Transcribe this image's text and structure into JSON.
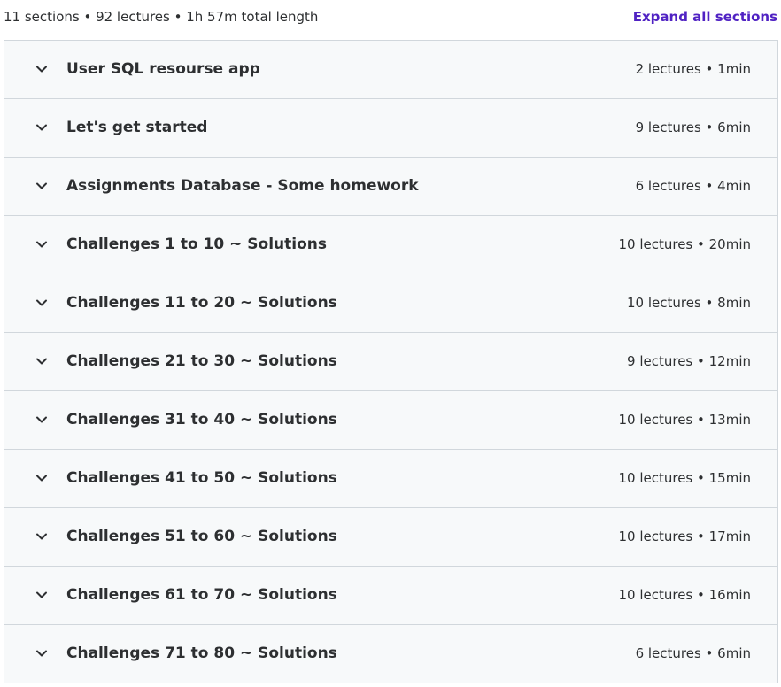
{
  "header": {
    "summary": "11 sections • 92 lectures • 1h 57m total length",
    "expand_all_label": "Expand all sections"
  },
  "icons": {
    "section_toggle": "chevron-down-icon"
  },
  "colors": {
    "accent": "#5022c3",
    "text": "#2d2f31",
    "row_background": "#f7f9fa",
    "border": "#d1d7dc"
  },
  "sections": [
    {
      "title": "User SQL resourse app",
      "meta": "2 lectures • 1min"
    },
    {
      "title": "Let's get started",
      "meta": "9 lectures • 6min"
    },
    {
      "title": "Assignments Database - Some homework",
      "meta": "6 lectures • 4min"
    },
    {
      "title": "Challenges 1 to 10 ~ Solutions",
      "meta": "10 lectures • 20min"
    },
    {
      "title": "Challenges 11 to 20 ~ Solutions",
      "meta": "10 lectures • 8min"
    },
    {
      "title": "Challenges 21 to 30 ~ Solutions",
      "meta": "9 lectures • 12min"
    },
    {
      "title": "Challenges 31 to 40 ~ Solutions",
      "meta": "10 lectures • 13min"
    },
    {
      "title": "Challenges 41 to 50 ~ Solutions",
      "meta": "10 lectures • 15min"
    },
    {
      "title": "Challenges 51 to 60 ~ Solutions",
      "meta": "10 lectures • 17min"
    },
    {
      "title": "Challenges 61 to 70 ~ Solutions",
      "meta": "10 lectures • 16min"
    },
    {
      "title": "Challenges 71 to 80 ~ Solutions",
      "meta": "6 lectures • 6min"
    }
  ]
}
